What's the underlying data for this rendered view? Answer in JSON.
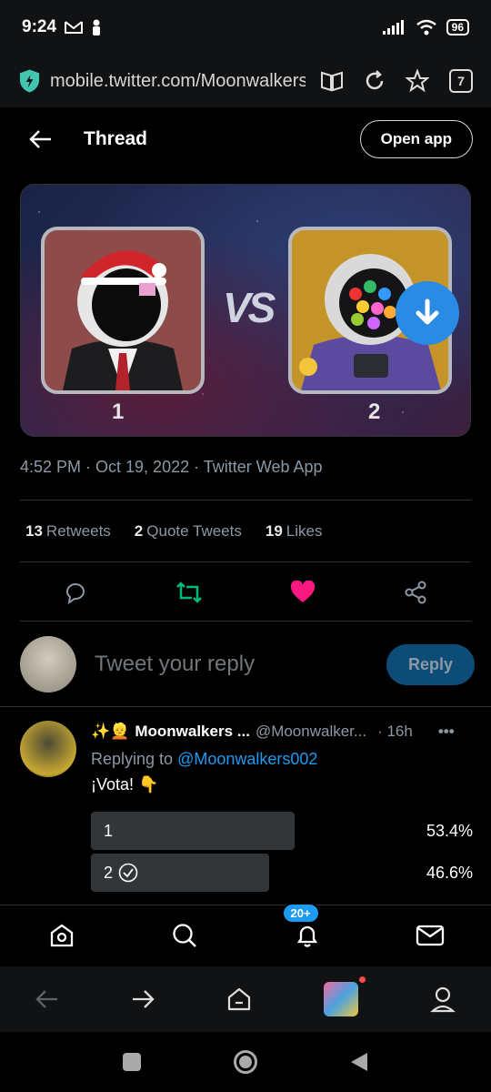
{
  "status_bar": {
    "time": "9:24",
    "battery": "96"
  },
  "browser": {
    "url": "mobile.twitter.com/Moonwalkers(",
    "tab_count": "7"
  },
  "header": {
    "title": "Thread",
    "open_app_label": "Open app"
  },
  "media": {
    "vs_text": "VS",
    "left_label": "1",
    "right_label": "2"
  },
  "tweet": {
    "meta": "4:52 PM · Oct 19, 2022 · Twitter Web App",
    "retweets_count": "13",
    "retweets_label": "Retweets",
    "quotes_count": "2",
    "quotes_label": "Quote Tweets",
    "likes_count": "19",
    "likes_label": "Likes"
  },
  "composer": {
    "placeholder": "Tweet your reply",
    "reply_label": "Reply"
  },
  "reply": {
    "name": "Moonwalkers ...",
    "handle": "@Moonwalker...",
    "time": "· 16h",
    "replying_prefix": "Replying to ",
    "replying_to": "@Moonwalkers002",
    "text": "¡Vota! 👇",
    "poll": [
      {
        "label": "1",
        "percent_text": "53.4%",
        "fraction": 0.534
      },
      {
        "label": "2",
        "percent_text": "46.6%",
        "fraction": 0.466
      }
    ]
  },
  "nav": {
    "notifications_badge": "20+"
  },
  "colors": {
    "accent": "#1d9bf0",
    "retweet_green": "#00ba7c",
    "like_pink": "#f91880"
  }
}
